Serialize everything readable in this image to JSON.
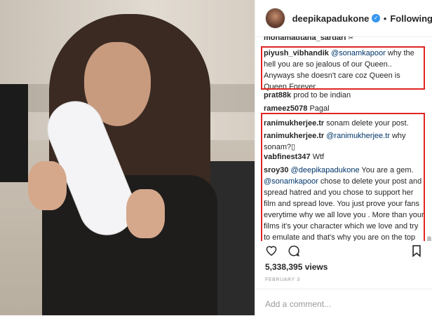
{
  "header": {
    "username": "deepikapadukone",
    "verified": "✓",
    "separator": "•",
    "follow_label": "Following"
  },
  "comments": [
    {
      "user": "monamadtana_sardari",
      "text": "",
      "cut": true
    },
    {
      "user": "piyush_vibhandik",
      "mention": "@sonamkapoor",
      "text": " why the hell you are so jealous of our Queen.. Anyways she doesn't care coz Queen is Queen Forever"
    },
    {
      "user": "prat88k",
      "text": "prod to be indian"
    },
    {
      "user": "rameez5078",
      "text": "Pagal"
    },
    {
      "user": "ranimukherjee.tr",
      "text": "sonam delete your post."
    },
    {
      "user": "ranimukherjee.tr",
      "mention": "@ranimukherjee.tr",
      "text": " why sonam?▯"
    },
    {
      "user": "vabfinest347",
      "text": "Wtf"
    },
    {
      "user": "sroy30",
      "mention": "@deepikapadukone",
      "text": " You are a gem. ",
      "mention2": "@sonamkapoor",
      "text2": " chose to delete your post and spread hatred and you chose to support her film and spread love. You just prove your fans everytime why we all love you . More than your films it's your character which we love and try to emulate and that's why you are on the top leaving"
    }
  ],
  "views": "5,338,395 views",
  "date": "FEBRUARY 3",
  "add_comment_placeholder": "Add a comment...",
  "colors": {
    "highlight_box": "#e02424",
    "link": "#003569",
    "verified": "#3897f0"
  }
}
